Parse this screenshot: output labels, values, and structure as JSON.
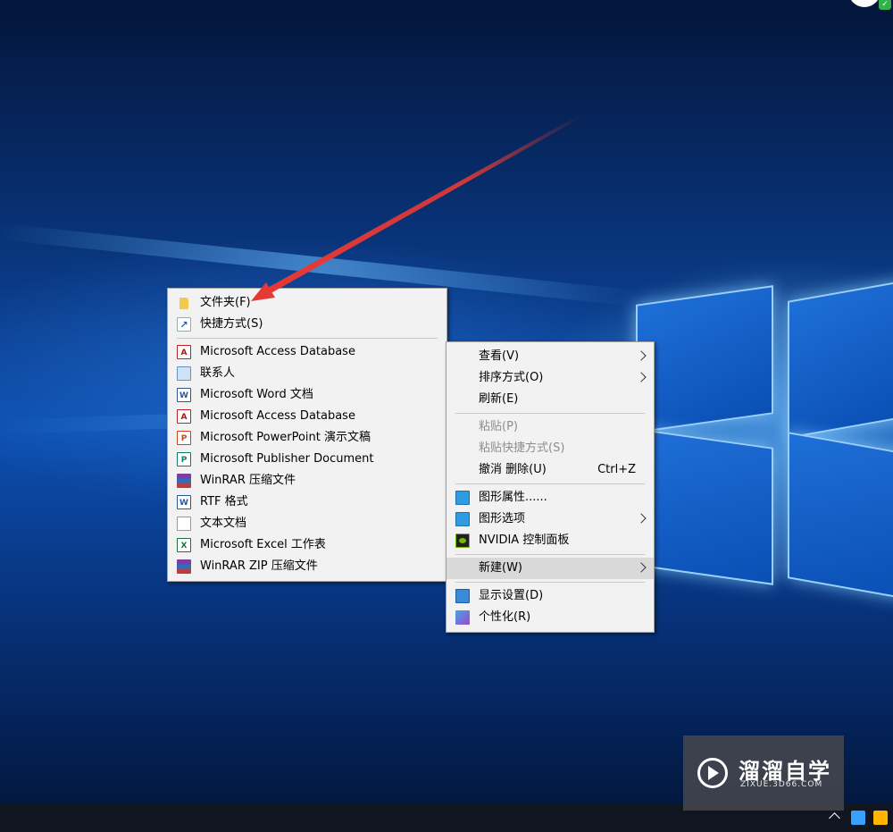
{
  "new_submenu": {
    "items": [
      {
        "label": "文件夹(F)",
        "icon": "folder-icon"
      },
      {
        "label": "快捷方式(S)",
        "icon": "shortcut-icon"
      },
      {
        "separator": true
      },
      {
        "label": "Microsoft Access Database",
        "icon": "access-icon"
      },
      {
        "label": "联系人",
        "icon": "contact-icon"
      },
      {
        "label": "Microsoft Word 文档",
        "icon": "word-icon"
      },
      {
        "label": "Microsoft Access Database",
        "icon": "access-icon"
      },
      {
        "label": "Microsoft PowerPoint 演示文稿",
        "icon": "powerpoint-icon"
      },
      {
        "label": "Microsoft Publisher Document",
        "icon": "publisher-icon"
      },
      {
        "label": "WinRAR 压缩文件",
        "icon": "winrar-icon"
      },
      {
        "label": "RTF 格式",
        "icon": "rtf-icon"
      },
      {
        "label": "文本文档",
        "icon": "text-document-icon"
      },
      {
        "label": "Microsoft Excel 工作表",
        "icon": "excel-icon"
      },
      {
        "label": "WinRAR ZIP 压缩文件",
        "icon": "winrar-zip-icon"
      }
    ]
  },
  "context_menu": {
    "items": [
      {
        "label": "查看(V)",
        "submenu": true
      },
      {
        "label": "排序方式(O)",
        "submenu": true
      },
      {
        "label": "刷新(E)"
      },
      {
        "separator": true
      },
      {
        "label": "粘贴(P)",
        "disabled": true
      },
      {
        "label": "粘贴快捷方式(S)",
        "disabled": true
      },
      {
        "label": "撤消 删除(U)",
        "shortcut": "Ctrl+Z"
      },
      {
        "separator": true
      },
      {
        "label": "图形属性......",
        "icon": "graphics-properties-icon"
      },
      {
        "label": "图形选项",
        "icon": "graphics-options-icon",
        "submenu": true
      },
      {
        "label": "NVIDIA 控制面板",
        "icon": "nvidia-icon"
      },
      {
        "separator": true
      },
      {
        "label": "新建(W)",
        "submenu": true,
        "highlighted": true
      },
      {
        "separator": true
      },
      {
        "label": "显示设置(D)",
        "icon": "display-settings-icon"
      },
      {
        "label": "个性化(R)",
        "icon": "personalize-icon"
      }
    ]
  },
  "watermark": {
    "title": "溜溜自学",
    "subtitle": "ZIXUE.3D66.COM"
  },
  "colors": {
    "annotation_arrow": "#e53935",
    "menu_background": "#f2f2f2",
    "menu_highlight": "#d9d9d9"
  }
}
